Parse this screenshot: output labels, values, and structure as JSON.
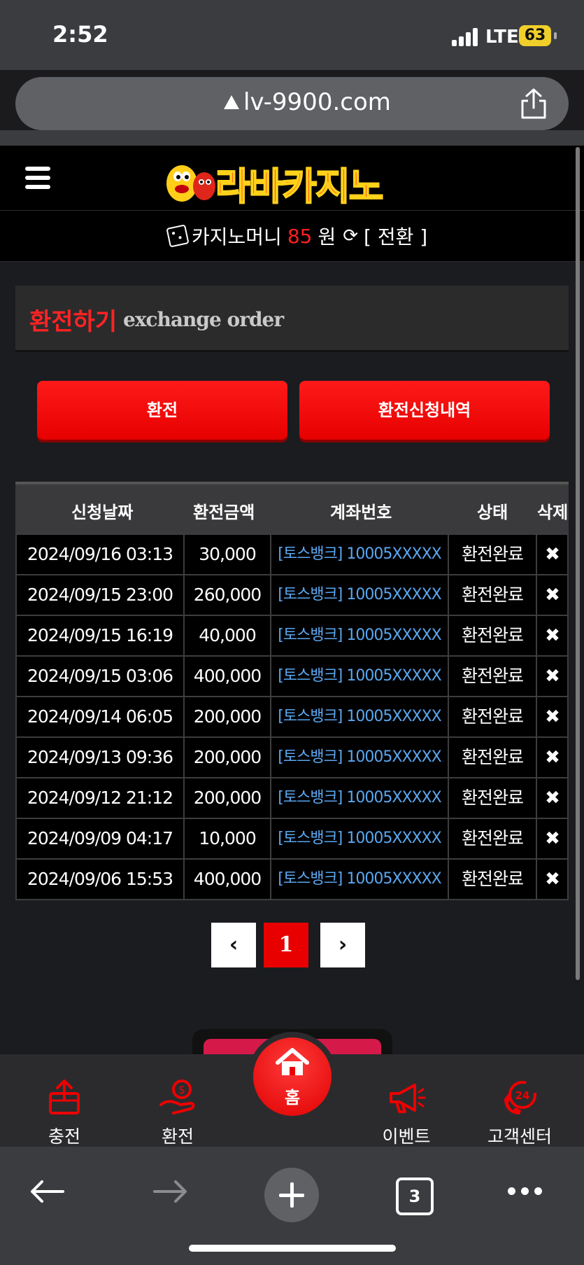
{
  "status_bar": {
    "time": "2:52",
    "network": "LTE",
    "battery": "63"
  },
  "browser": {
    "url": "lv-9900.com",
    "tab_count": "3"
  },
  "header": {
    "logo_text": "라바카지노",
    "menu_icon": "hamburger-icon"
  },
  "money_bar": {
    "label": "카지노머니",
    "amount": "85",
    "unit": "원",
    "convert_label": "[ 전환 ]"
  },
  "section": {
    "title": "환전하기",
    "subtitle": "exchange order"
  },
  "actions": {
    "exchange_label": "환전",
    "history_label": "환전신청내역"
  },
  "table": {
    "headers": [
      "신청날짜",
      "환전금액",
      "계좌번호",
      "상태",
      "삭제"
    ],
    "rows": [
      {
        "date": "2024/09/16 03:13",
        "amount": "30,000",
        "account": "[토스뱅크] 10005XXXXX",
        "status": "환전완료",
        "delete": "✖"
      },
      {
        "date": "2024/09/15 23:00",
        "amount": "260,000",
        "account": "[토스뱅크] 10005XXXXX",
        "status": "환전완료",
        "delete": "✖"
      },
      {
        "date": "2024/09/15 16:19",
        "amount": "40,000",
        "account": "[토스뱅크] 10005XXXXX",
        "status": "환전완료",
        "delete": "✖"
      },
      {
        "date": "2024/09/15 03:06",
        "amount": "400,000",
        "account": "[토스뱅크] 10005XXXXX",
        "status": "환전완료",
        "delete": "✖"
      },
      {
        "date": "2024/09/14 06:05",
        "amount": "200,000",
        "account": "[토스뱅크] 10005XXXXX",
        "status": "환전완료",
        "delete": "✖"
      },
      {
        "date": "2024/09/13 09:36",
        "amount": "200,000",
        "account": "[토스뱅크] 10005XXXXX",
        "status": "환전완료",
        "delete": "✖"
      },
      {
        "date": "2024/09/12 21:12",
        "amount": "200,000",
        "account": "[토스뱅크] 10005XXXXX",
        "status": "환전완료",
        "delete": "✖"
      },
      {
        "date": "2024/09/09 04:17",
        "amount": "10,000",
        "account": "[토스뱅크] 10005XXXXX",
        "status": "환전완료",
        "delete": "✖"
      },
      {
        "date": "2024/09/06 15:53",
        "amount": "400,000",
        "account": "[토스뱅크] 10005XXXXX",
        "status": "환전완료",
        "delete": "✖"
      }
    ]
  },
  "pagination": {
    "prev": "‹",
    "current": "1",
    "next": "›"
  },
  "bottom_nav": {
    "items": [
      {
        "label": "충전",
        "icon": "deposit-icon"
      },
      {
        "label": "환전",
        "icon": "exchange-icon"
      },
      {
        "label": "홈",
        "icon": "home-icon"
      },
      {
        "label": "이벤트",
        "icon": "megaphone-icon"
      },
      {
        "label": "고객센터",
        "icon": "support-24-icon"
      }
    ]
  },
  "colors": {
    "accent_red": "#ff1a1a",
    "account_link": "#5aa7f0",
    "background": "#1b1c1f"
  }
}
